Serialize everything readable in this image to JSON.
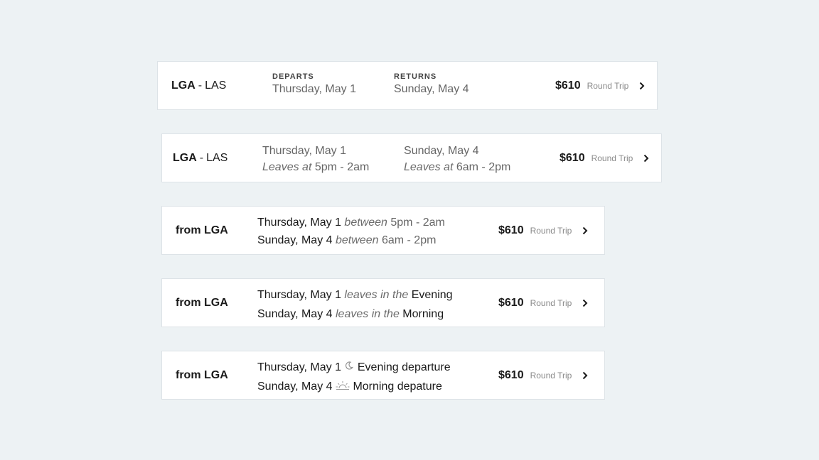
{
  "cards": [
    {
      "origin": "LGA",
      "separator": "-",
      "destination": "LAS",
      "departs_label": "DEPARTS",
      "departs_date": "Thursday, May 1",
      "returns_label": "RETURNS",
      "returns_date": "Sunday, May 4",
      "price": "$610",
      "trip_type": "Round Trip"
    },
    {
      "origin": "LGA",
      "separator": "-",
      "destination": "LAS",
      "depart_date": "Thursday, May 1",
      "depart_leaves_label": "Leaves at",
      "depart_time": "5pm - 2am",
      "return_date": "Sunday, May 4",
      "return_leaves_label": "Leaves at",
      "return_time": "6am - 2pm",
      "price": "$610",
      "trip_type": "Round Trip"
    },
    {
      "from_label": "from LGA",
      "depart_date": "Thursday, May 1",
      "depart_between": "between",
      "depart_time": "5pm - 2am",
      "return_date": "Sunday, May 4",
      "return_between": "between",
      "return_time": "6am - 2pm",
      "price": "$610",
      "trip_type": "Round Trip"
    },
    {
      "from_label": "from LGA",
      "depart_date": "Thursday, May 1",
      "depart_phrase": "leaves in the",
      "depart_period": "Evening",
      "return_date": "Sunday, May 4",
      "return_phrase": "leaves in the",
      "return_period": "Morning",
      "price": "$610",
      "trip_type": "Round Trip"
    },
    {
      "from_label": "from LGA",
      "depart_date": "Thursday, May 1",
      "depart_icon": "moon-icon",
      "depart_text": "Evening departure",
      "return_date": "Sunday, May 4",
      "return_icon": "sunrise-icon",
      "return_text": "Morning depature",
      "price": "$610",
      "trip_type": "Round Trip"
    }
  ]
}
